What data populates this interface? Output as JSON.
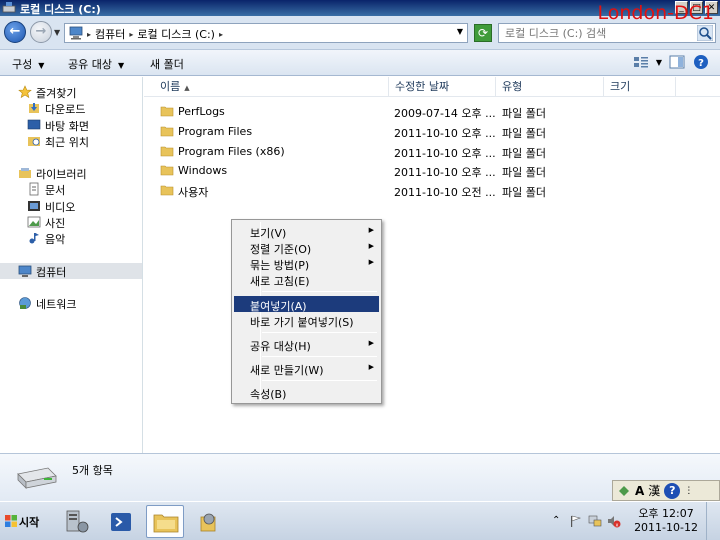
{
  "window": {
    "title": "로컬 디스크 (C:)"
  },
  "watermark": "London-DC1",
  "address": {
    "crumbs": [
      "컴퓨터",
      "로컬 디스크 (C:)"
    ],
    "search_placeholder": "로컬 디스크 (C:) 검색"
  },
  "toolbar": {
    "organize": "구성",
    "share": "공유 대상",
    "new_folder": "새 폴더"
  },
  "nav": {
    "favorites": "즐겨찾기",
    "downloads": "다운로드",
    "desktop": "바탕 화면",
    "recent": "최근 위치",
    "libraries": "라이브러리",
    "documents": "문서",
    "videos": "비디오",
    "pictures": "사진",
    "music": "음악",
    "computer": "컴퓨터",
    "network": "네트워크"
  },
  "columns": {
    "name": "이름",
    "modified": "수정한 날짜",
    "type": "유형",
    "size": "크기"
  },
  "files": [
    {
      "name": "PerfLogs",
      "date": "2009-07-14 오후 ...",
      "type": "파일 폴더"
    },
    {
      "name": "Program Files",
      "date": "2011-10-10 오후 ...",
      "type": "파일 폴더"
    },
    {
      "name": "Program Files (x86)",
      "date": "2011-10-10 오후 ...",
      "type": "파일 폴더"
    },
    {
      "name": "Windows",
      "date": "2011-10-10 오후 ...",
      "type": "파일 폴더"
    },
    {
      "name": "사용자",
      "date": "2011-10-10 오전 ...",
      "type": "파일 폴더"
    }
  ],
  "context_menu": {
    "view": "보기(V)",
    "sort_by": "정렬 기준(O)",
    "group_by": "묶는 방법(P)",
    "refresh": "새로 고침(E)",
    "paste": "붙여넣기(A)",
    "paste_shortcut": "바로 가기 붙여넣기(S)",
    "share_with": "공유 대상(H)",
    "new": "새로 만들기(W)",
    "properties": "속성(B)"
  },
  "details": {
    "item_count": "5개 항목"
  },
  "ime": {
    "mode": "A",
    "hanja": "漢"
  },
  "taskbar": {
    "start": "시작",
    "time": "오후 12:07",
    "date": "2011-10-12"
  },
  "colors": {
    "menu_highlight": "#1c3b7c",
    "watermark": "#e01010",
    "folder": "#e8c35a"
  }
}
